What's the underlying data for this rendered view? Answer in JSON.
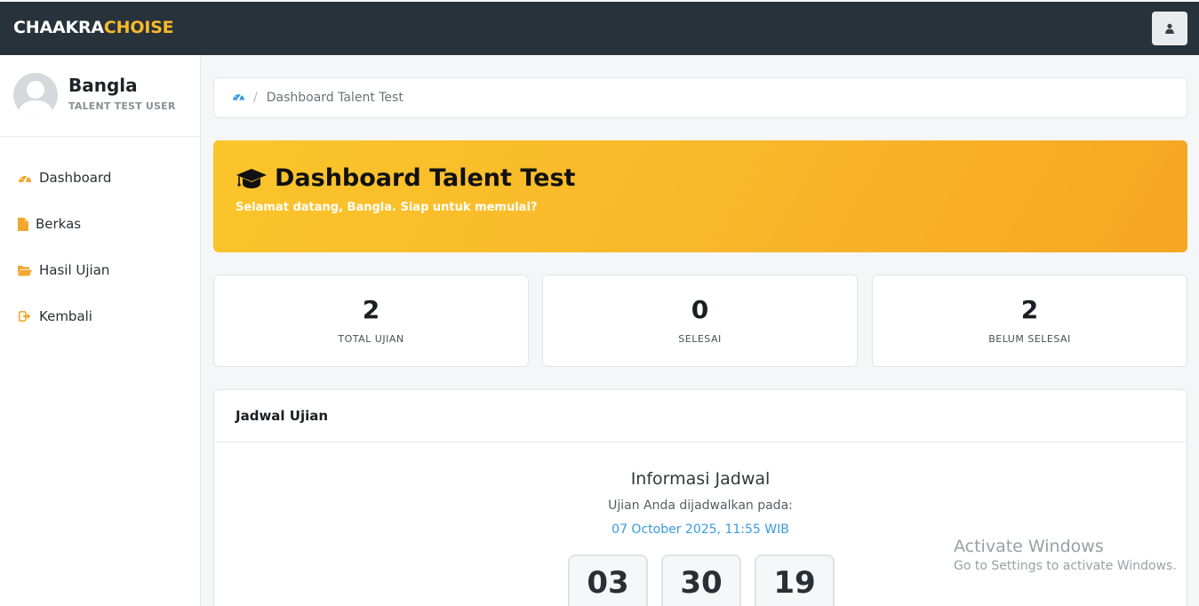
{
  "brand": {
    "part1": "CHAAKRA",
    "part2": "CHOISE"
  },
  "header": {
    "user_icon": "user-icon"
  },
  "profile": {
    "name": "Bangla",
    "role": "TALENT TEST USER"
  },
  "sidebar": {
    "items": [
      {
        "label": "Dashboard",
        "icon": "dashboard-icon"
      },
      {
        "label": "Berkas",
        "icon": "file-icon"
      },
      {
        "label": "Hasil Ujian",
        "icon": "folder-open-icon"
      },
      {
        "label": "Kembali",
        "icon": "sign-out-icon"
      }
    ]
  },
  "breadcrumb": {
    "separator": "/",
    "current": "Dashboard Talent Test"
  },
  "hero": {
    "title": "Dashboard Talent Test",
    "subtitle": "Selamat datang, Bangla. Siap untuk memulai?"
  },
  "stats": [
    {
      "value": "2",
      "label": "TOTAL UJIAN"
    },
    {
      "value": "0",
      "label": "SELESAI"
    },
    {
      "value": "2",
      "label": "BELUM SELESAI"
    }
  ],
  "schedule": {
    "heading": "Jadwal Ujian",
    "info_title": "Informasi Jadwal",
    "info_sub": "Ujian Anda dijadwalkan pada:",
    "date": "07 October 2025, 11:55 WIB",
    "countdown": [
      "03",
      "30",
      "19"
    ]
  },
  "watermark": {
    "line1": "Activate Windows",
    "line2": "Go to Settings to activate Windows."
  },
  "colors": {
    "topbar": "#27323a",
    "accent": "#f9b92a",
    "link": "#3a9be0"
  }
}
